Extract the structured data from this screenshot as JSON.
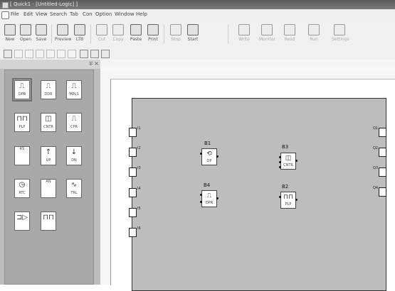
{
  "window": {
    "title": "[ Quick1 - [Untitled-Logic] ]"
  },
  "menu": [
    "File",
    "Edit",
    "View",
    "Search",
    "Tab",
    "Con",
    "Option",
    "Window",
    "Help"
  ],
  "toolbar": [
    {
      "label": "New",
      "icon": "new-file-icon",
      "enabled": true
    },
    {
      "label": "Open",
      "icon": "open-folder-icon",
      "enabled": true
    },
    {
      "label": "Save",
      "icon": "save-icon",
      "enabled": true
    },
    {
      "label": "Preview",
      "icon": "print-preview-icon",
      "enabled": true
    },
    {
      "label": "LTB",
      "icon": "ltb-icon",
      "enabled": true
    },
    {
      "label": "Cut",
      "icon": "cut-icon",
      "enabled": false
    },
    {
      "label": "Copy",
      "icon": "copy-icon",
      "enabled": false
    },
    {
      "label": "Paste",
      "icon": "paste-icon",
      "enabled": true
    },
    {
      "label": "Print",
      "icon": "print-icon",
      "enabled": true
    },
    {
      "label": "Stop",
      "icon": "stop-icon",
      "enabled": false
    },
    {
      "label": "Start",
      "icon": "start-icon",
      "enabled": true
    },
    {
      "label": "Write",
      "icon": "write-icon",
      "enabled": false
    },
    {
      "label": "Monitor",
      "icon": "monitor-icon",
      "enabled": false
    },
    {
      "label": "Read",
      "icon": "read-icon",
      "enabled": false
    },
    {
      "label": "Run",
      "icon": "run-icon",
      "enabled": false
    },
    {
      "label": "Settings",
      "icon": "settings-icon",
      "enabled": false
    }
  ],
  "panel": {
    "pin": "∓",
    "close": "×"
  },
  "palette": [
    {
      "glyph": "⎍",
      "label": "DPR"
    },
    {
      "glyph": "⎍",
      "label": "DDR"
    },
    {
      "glyph": "⎍",
      "label": "MPLS"
    },
    {
      "glyph": "⊓⊓",
      "label": "PLP"
    },
    {
      "glyph": "◫",
      "label": "CNTR"
    },
    {
      "glyph": "⎍",
      "label": "CPR"
    },
    {
      "glyph": "",
      "label": "RS"
    },
    {
      "glyph": "↑",
      "label": "UP"
    },
    {
      "glyph": "↓",
      "label": "DN"
    },
    {
      "glyph": "◷",
      "label": "RTC"
    },
    {
      "glyph": "",
      "label": "AN"
    },
    {
      "glyph": "∿",
      "label": "TRL"
    },
    {
      "glyph": "⊐▷",
      "label": ""
    },
    {
      "glyph": "⊓⊓",
      "label": ""
    }
  ],
  "canvas": {
    "left_terminals": [
      "I1",
      "I2",
      "I3",
      "I4",
      "I5",
      "I6"
    ],
    "right_terminals": [
      "Q1",
      "Q2",
      "Q3",
      "Q4"
    ],
    "blocks": [
      {
        "name": "B1",
        "glyph": "⟲",
        "label": "OP"
      },
      {
        "name": "B3",
        "glyph": "◫",
        "label": "CNTR"
      },
      {
        "name": "B4",
        "glyph": "⎍",
        "label": "DPR"
      },
      {
        "name": "B2",
        "glyph": "⊓⊓",
        "label": "PLP"
      }
    ]
  }
}
